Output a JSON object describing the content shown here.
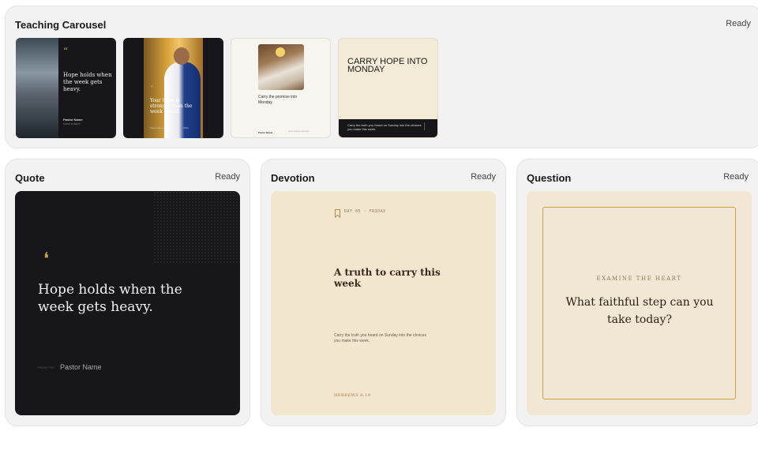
{
  "carousel": {
    "title": "Teaching Carousel",
    "status": "Ready",
    "slides": [
      {
        "quote_mark": "“",
        "quote": "Hope holds when the week gets heavy.",
        "name": "Pastor Name",
        "sub": "FROM SUNDAY"
      },
      {
        "quote_mark": "“",
        "quote": "Your hope is stronger than the week ahead.",
        "left": "Pastor Name",
        "right": "2024"
      },
      {
        "text": "Carry the promise into Monday.",
        "name": "Pastor Name",
        "fine": "FROM SUNDAY'S MESSAGE"
      },
      {
        "headline": "CARRY HOPE INTO MONDAY",
        "footer": "Carry the truth you heard on Sunday into the choices you make this week."
      }
    ]
  },
  "quote_card": {
    "title": "Quote",
    "status": "Ready",
    "quote_mark": "❛",
    "quote": "Hope holds when the week gets heavy.",
    "name_prefix": "FROM THE",
    "name": "Pastor Name"
  },
  "devotion_card": {
    "title": "Devotion",
    "status": "Ready",
    "day": "DAY 05 · FRIDAY",
    "headline": "A truth to carry this week",
    "body": "Carry the truth you heard on Sunday into the choices you make this week.",
    "reference": "HEBREWS 6:19"
  },
  "question_card": {
    "title": "Question",
    "status": "Ready",
    "eyebrow": "EXAMINE THE HEART",
    "question": "What faithful step can you take today?"
  },
  "colors": {
    "dark": "#17171b",
    "cream": "#f3e8d4",
    "gold": "#c9a24c",
    "brown": "#3a2a1a"
  }
}
